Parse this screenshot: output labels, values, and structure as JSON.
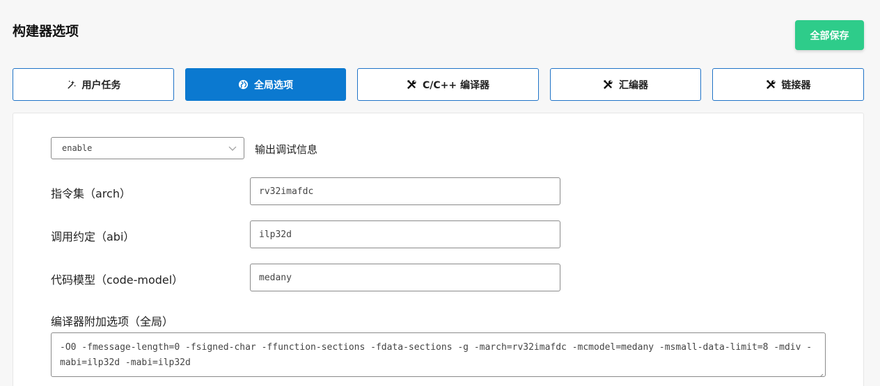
{
  "page": {
    "title": "构建器选项",
    "save_label": "全部保存"
  },
  "tabs": [
    {
      "label": "用户任务",
      "icon": "wand-icon",
      "active": false
    },
    {
      "label": "全局选项",
      "icon": "globe-icon",
      "active": true
    },
    {
      "label": "C/C++ 编译器",
      "icon": "tools-icon",
      "active": false
    },
    {
      "label": "汇编器",
      "icon": "tools-icon",
      "active": false
    },
    {
      "label": "链接器",
      "icon": "tools-icon",
      "active": false
    }
  ],
  "debug": {
    "value": "enable",
    "label": "输出调试信息"
  },
  "fields": {
    "arch": {
      "label": "指令集（arch）",
      "value": "rv32imafdc"
    },
    "abi": {
      "label": "调用约定（abi）",
      "value": "ilp32d"
    },
    "code_model": {
      "label": "代码模型（code-model）",
      "value": "medany"
    }
  },
  "extra": {
    "label": "编译器附加选项（全局）",
    "value": "-O0 -fmessage-length=0 -fsigned-char -ffunction-sections -fdata-sections -g -march=rv32imafdc -mcmodel=medany -msmall-data-limit=8 -mdiv -mabi=ilp32d -mabi=ilp32d"
  },
  "colors": {
    "save": "#2ecc8a",
    "tab_active": "#0b79d0",
    "tab_border": "#1f73c7"
  }
}
